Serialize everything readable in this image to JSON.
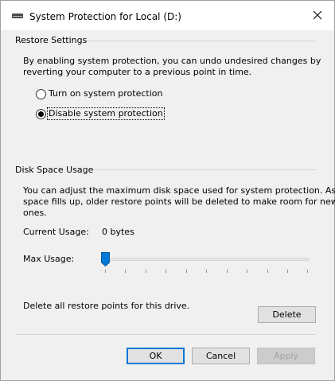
{
  "window": {
    "title": "System Protection for Local (D:)",
    "title_icon": "drive-icon",
    "close_icon": "close-icon"
  },
  "restore_settings": {
    "header": "Restore Settings",
    "description_line1": "By enabling system protection, you can undo undesired changes by",
    "description_line2": "reverting your computer to a previous point in time.",
    "options": [
      {
        "label": "Turn on system protection",
        "checked": false
      },
      {
        "label": "Disable system protection",
        "checked": true
      }
    ]
  },
  "disk_space": {
    "header": "Disk Space Usage",
    "description_line1": "You can adjust the maximum disk space used for system protection. As",
    "description_line2": "space fills up, older restore points will be deleted to make room for new",
    "description_line3": "ones.",
    "current_usage_label": "Current Usage:",
    "current_usage_value": "0 bytes",
    "max_usage_label": "Max Usage:",
    "max_usage_level": 0,
    "delete_text": "Delete all restore points for this drive.",
    "delete_button": "Delete"
  },
  "buttons": {
    "ok": "OK",
    "cancel": "Cancel",
    "apply": "Apply"
  },
  "colors": {
    "accent": "#0078d7",
    "window_bg": "#f0f0f0",
    "titlebar_bg": "#ffffff"
  }
}
